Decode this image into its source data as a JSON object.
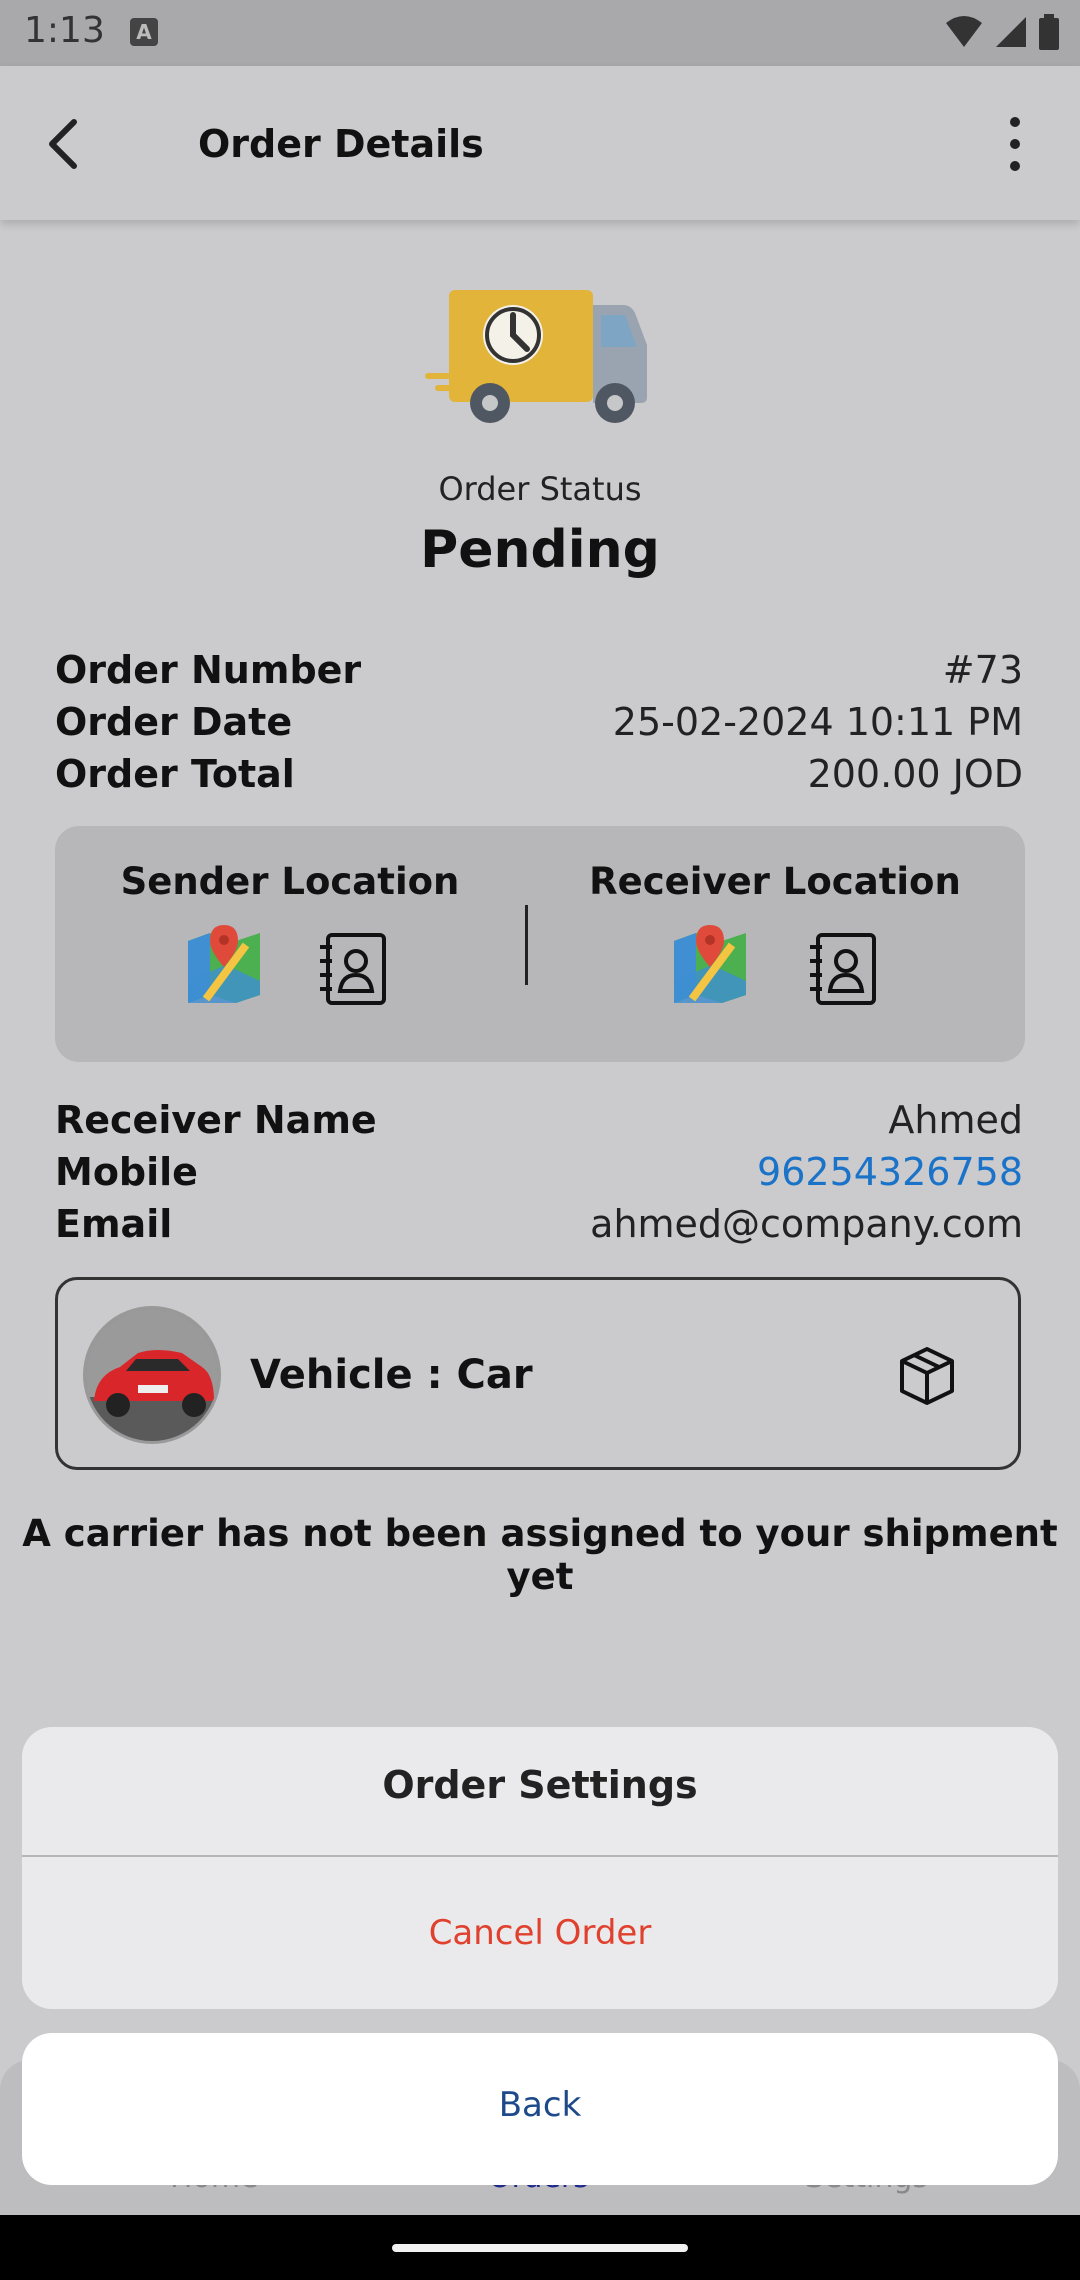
{
  "status_bar": {
    "time": "1:13",
    "notification_icon": "A"
  },
  "app_bar": {
    "title": "Order Details"
  },
  "order": {
    "status_label": "Order Status",
    "status_value": "Pending",
    "number_label": "Order Number",
    "number_value": "#73",
    "date_label": "Order Date",
    "date_value": "25-02-2024 10:11 PM",
    "total_label": "Order Total",
    "total_value": "200.00 JOD"
  },
  "locations": {
    "sender_title": "Sender Location",
    "receiver_title": "Receiver Location"
  },
  "receiver": {
    "name_label": "Receiver Name",
    "name_value": "Ahmed",
    "mobile_label": "Mobile",
    "mobile_value": "96254326758",
    "email_label": "Email",
    "email_value": "ahmed@company.com"
  },
  "vehicle": {
    "text": "Vehicle : Car"
  },
  "notice": "A carrier has not been assigned to your shipment yet",
  "bottom_nav": {
    "items": [
      "Home",
      "Orders",
      "Settings"
    ]
  },
  "action_sheet": {
    "title": "Order Settings",
    "cancel_label": "Cancel Order",
    "back_label": "Back"
  },
  "colors": {
    "cancel": "#e0412e",
    "link": "#1a73c8",
    "back": "#1e4a8a"
  }
}
